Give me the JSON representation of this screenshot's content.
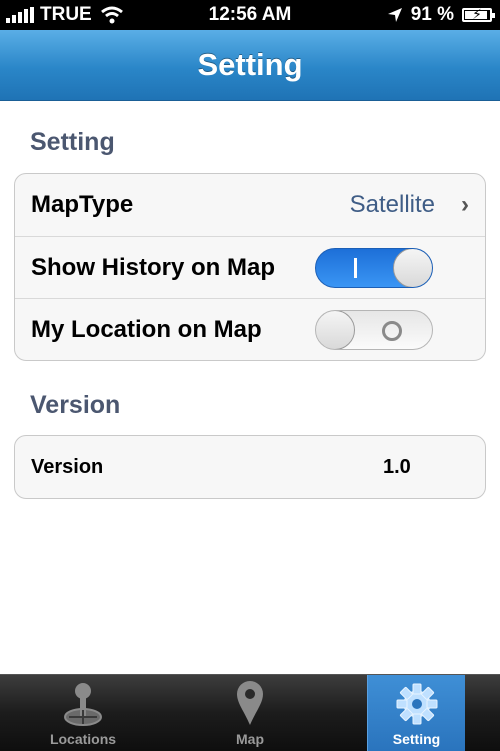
{
  "status_bar": {
    "carrier": "TRUE",
    "time": "12:56 AM",
    "battery_text": "91 %",
    "battery_level": 0.91,
    "icons": [
      "signal-icon",
      "wifi-icon",
      "location-arrow-icon",
      "battery-icon"
    ]
  },
  "nav": {
    "title": "Setting"
  },
  "sections": {
    "setting": {
      "title": "Setting",
      "rows": [
        {
          "label": "MapType",
          "value": "Satellite"
        },
        {
          "label": "Show History on Map",
          "toggle": true
        },
        {
          "label": "My Location on Map",
          "toggle": false
        }
      ]
    },
    "version": {
      "title": "Version",
      "row": {
        "label": "Version",
        "value": "1.0"
      }
    }
  },
  "tabbar": {
    "tabs": [
      {
        "label": "Locations",
        "icon": "joystick-icon",
        "active": false
      },
      {
        "label": "Map",
        "icon": "map-pin-icon",
        "active": false
      },
      {
        "label": "Setting",
        "icon": "gear-icon",
        "active": true
      }
    ]
  },
  "colors": {
    "nav_blue": "#2a86c8",
    "toggle_on": "#2f85e8",
    "section_title": "#4b5770",
    "value_text": "#3f5d86",
    "active_tab": "#3381ca"
  }
}
